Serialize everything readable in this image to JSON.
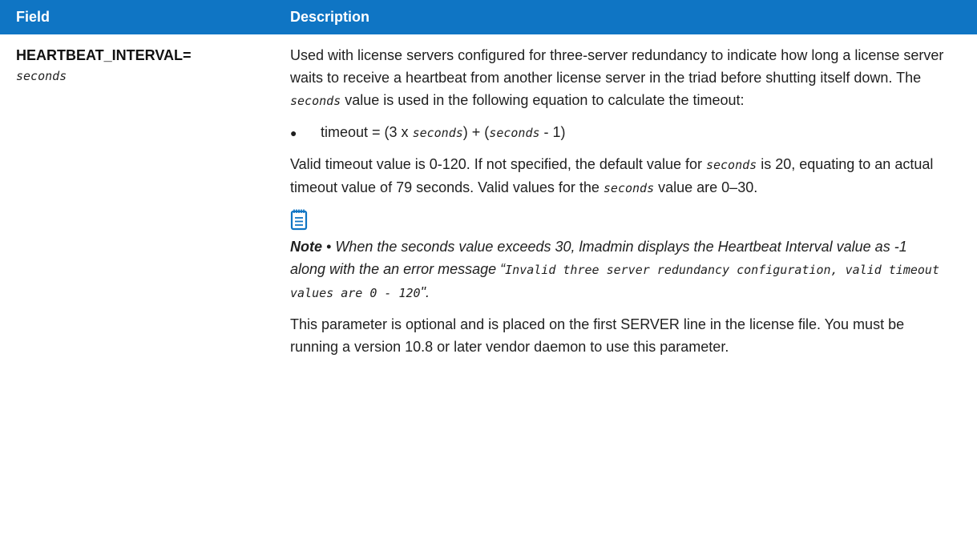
{
  "header": {
    "field_label": "Field",
    "description_label": "Description"
  },
  "row": {
    "field_name": "HEARTBEAT_INTERVAL=",
    "field_value": "seconds",
    "para1_a": "Used with license servers configured for three-server redundancy to indicate how long a license server waits to receive a heartbeat from another license server in the triad before shutting itself down. The ",
    "para1_code": "seconds",
    "para1_b": " value is used in the following equation to calculate the timeout:",
    "bullet_a": "timeout = (3 x ",
    "bullet_code1": "seconds",
    "bullet_b": ") + (",
    "bullet_code2": "seconds",
    "bullet_c": " - 1)",
    "para2_a": "Valid timeout value is 0-120. If not specified, the default value for ",
    "para2_code1": "seconds",
    "para2_b": " is 20, equating to an actual timeout value of 79 seconds. Valid values for the ",
    "para2_code2": "seconds",
    "para2_c": " value are 0–30.",
    "note_label": "Note",
    "note_sep": " • ",
    "note_text": "When the seconds value exceeds 30, lmadmin displays the Heartbeat Interval value as -1 along with the an error message “",
    "note_code": "Invalid three server redundancy configuration, valid timeout values are 0 - 120",
    "note_end": "\".",
    "para3": "This parameter is optional and is placed on the first SERVER line in the license file. You must be running a version 10.8 or later vendor daemon to use this parameter.",
    "note_icon": "notepad-icon",
    "accent_color": "#0f75c4"
  }
}
